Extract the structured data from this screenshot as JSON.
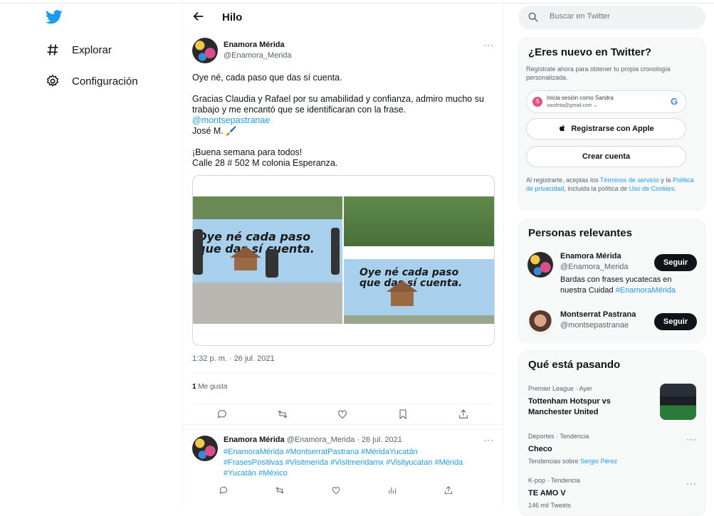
{
  "nav": {
    "items": [
      {
        "label": "Explorar",
        "icon": "hashtag-icon"
      },
      {
        "label": "Configuración",
        "icon": "gear-icon"
      }
    ]
  },
  "header": {
    "title": "Hilo"
  },
  "tweet": {
    "author_name": "Enamora Mérida",
    "author_handle": "@Enamora_Merida",
    "line1": "Oye né, cada paso que das sí cuenta.",
    "line2": "Gracias Claudia y Rafael por su amabilidad y confianza, admiro mucho su trabajo y me encantó que se identificaran con la frase.",
    "mention": "@montsepastranae",
    "signature": "José M. 🖌️",
    "line3": "¡Buena semana para todos!",
    "line4": "Calle 28 # 502 M colonia Esperanza.",
    "mural_text_1": "Oye né cada paso que das sí cuenta.",
    "mural_text_2": "Oye né cada paso que das sí cuenta.",
    "time": "1:32 p. m. · 26 jul. 2021",
    "likes_count": "1",
    "likes_label": "Me gusta"
  },
  "reply": {
    "author_name": "Enamora Mérida",
    "handle_date": "@Enamora_Merida · 26 jul. 2021",
    "hashtags_1": "#EnamoraMérida #MontserratPastrana #MéridaYucatán",
    "hashtags_2": "#FrasesPositivas #Visitmerida #Visitmeridamx #Visityucatan #Mérida",
    "hashtags_3": "#Yucatán #México"
  },
  "search": {
    "placeholder": "Buscar en Twitter"
  },
  "signup": {
    "title": "¿Eres nuevo en Twitter?",
    "subtitle": "Regístrate ahora para obtener tu propia cronología personalizada.",
    "google_line1": "Inicia sesión como Sandra",
    "google_line2": "sasdrita@gmail.com",
    "google_initial": "S",
    "apple_label": "Registrarse con Apple",
    "create_label": "Crear cuenta",
    "legal_prefix": "Al registrarte, aceptas los ",
    "legal_terms": "Términos de servicio",
    "legal_mid": " y la ",
    "legal_privacy": "Política de privacidad",
    "legal_mid2": ", incluida la política de ",
    "legal_cookies": "Uso de Cookies",
    "legal_end": "."
  },
  "people": {
    "title": "Personas relevantes",
    "items": [
      {
        "name": "Enamora Mérida",
        "handle": "@Enamora_Merida",
        "bio": "Bardas con frases yucatecas en nuestra Cuidad ",
        "bio_tag": "#EnamoraMérida",
        "button": "Seguir"
      },
      {
        "name": "Montserrat Pastrana",
        "handle": "@montsepastranae",
        "button": "Seguir"
      }
    ]
  },
  "trends": {
    "title": "Qué está pasando",
    "items": [
      {
        "context": "Premier League · Ayer",
        "title": "Tottenham Hotspur vs Manchester United"
      },
      {
        "context": "Deportes · Tendencia",
        "title": "Checo",
        "note_prefix": "Tendencias sobre ",
        "note_link": "Sergio Pérez"
      },
      {
        "context": "K-pop · Tendencia",
        "title": "TE AMO V",
        "note": "146 mil Tweets"
      }
    ]
  },
  "colors": {
    "accent": "#1d9bf0",
    "text": "#0f1419",
    "muted": "#536471"
  }
}
